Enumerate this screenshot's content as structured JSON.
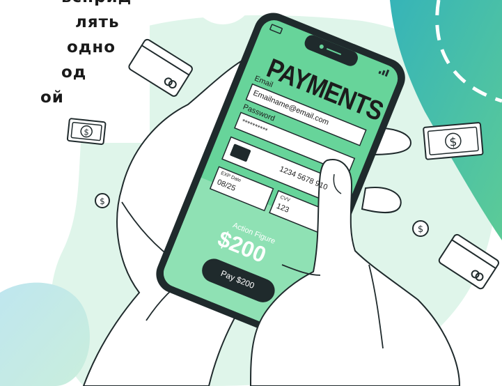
{
  "left_text": {
    "line1": "ьсприд",
    "line2": "лять",
    "line3": "одно",
    "line4": "од",
    "line5": "ой"
  },
  "phone": {
    "title": "PAYMENTS",
    "email_label": "Email",
    "email_value": "Emailname@email.com",
    "password_label": "Password",
    "password_value": "**********",
    "card_number": "1234 5678 910",
    "exp_label": "EXP Date",
    "exp_value": "08/25",
    "cvv_label": "CVV",
    "cvv_value": "123",
    "item_name": "Action Figure",
    "price": "$200",
    "pay_button": "Pay $200"
  },
  "colors": {
    "phone_screen": "#67d49a",
    "phone_screen_light": "#8fe1b4",
    "phone_frame": "#1f2a2c",
    "background_blob": "#dff5ea",
    "teal_accent": "#3bb7b0"
  },
  "icons": [
    "dollar-coin-icon",
    "dollar-bill-icon",
    "credit-card-icon"
  ]
}
